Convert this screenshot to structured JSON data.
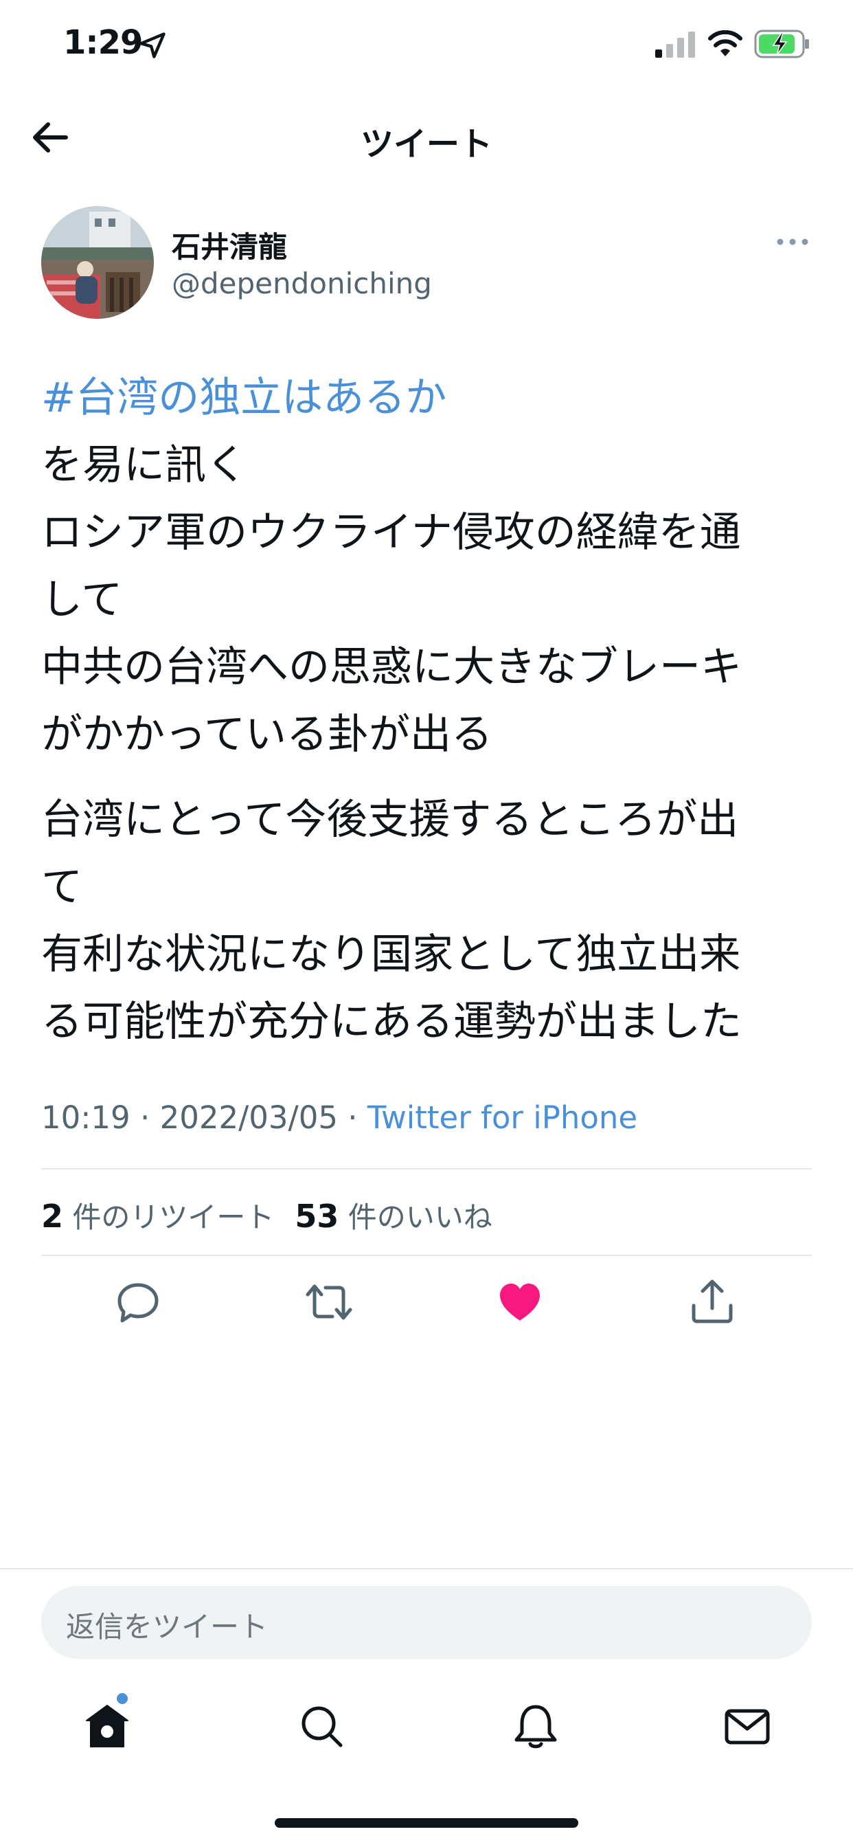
{
  "status_bar": {
    "time": "1:29",
    "icons": [
      "location-arrow-icon",
      "cellular-signal-icon",
      "wifi-icon",
      "battery-charging-icon"
    ],
    "battery_color": "#4cd964"
  },
  "nav": {
    "title": "ツイート",
    "back_icon": "arrow-left-icon"
  },
  "author": {
    "name": "石井清龍",
    "handle": "@dependoniching"
  },
  "tweet": {
    "hashtag": "#台湾の独立はあるか",
    "lines": [
      "を易に訊く",
      "ロシア軍のウクライナ侵攻の経緯を通",
      "して",
      "中共の台湾への思惑に大きなブレーキ",
      "がかかっている卦が出る"
    ],
    "lines2": [
      "台湾にとって今後支援するところが出",
      "て",
      "有利な状況になり国家として独立出来",
      "る可能性が充分にある運勢が出ました"
    ]
  },
  "meta": {
    "time": "10:19",
    "separator": " · ",
    "date": "2022/03/05",
    "source": "Twitter for iPhone"
  },
  "stats": {
    "retweet_count": "2",
    "retweet_label": "件のリツイート",
    "like_count": "53",
    "like_label": "件のいいね"
  },
  "actions": {
    "icons": [
      "reply-icon",
      "retweet-icon",
      "like-icon",
      "share-icon"
    ],
    "like_active_color": "#f91880"
  },
  "reply": {
    "placeholder": "返信をツイート"
  },
  "tab_bar": {
    "icons": [
      "home-icon",
      "search-icon",
      "notifications-icon",
      "messages-icon"
    ]
  },
  "colors": {
    "link": "#4a90d9",
    "text": "#0f1419",
    "secondary": "#536471"
  }
}
